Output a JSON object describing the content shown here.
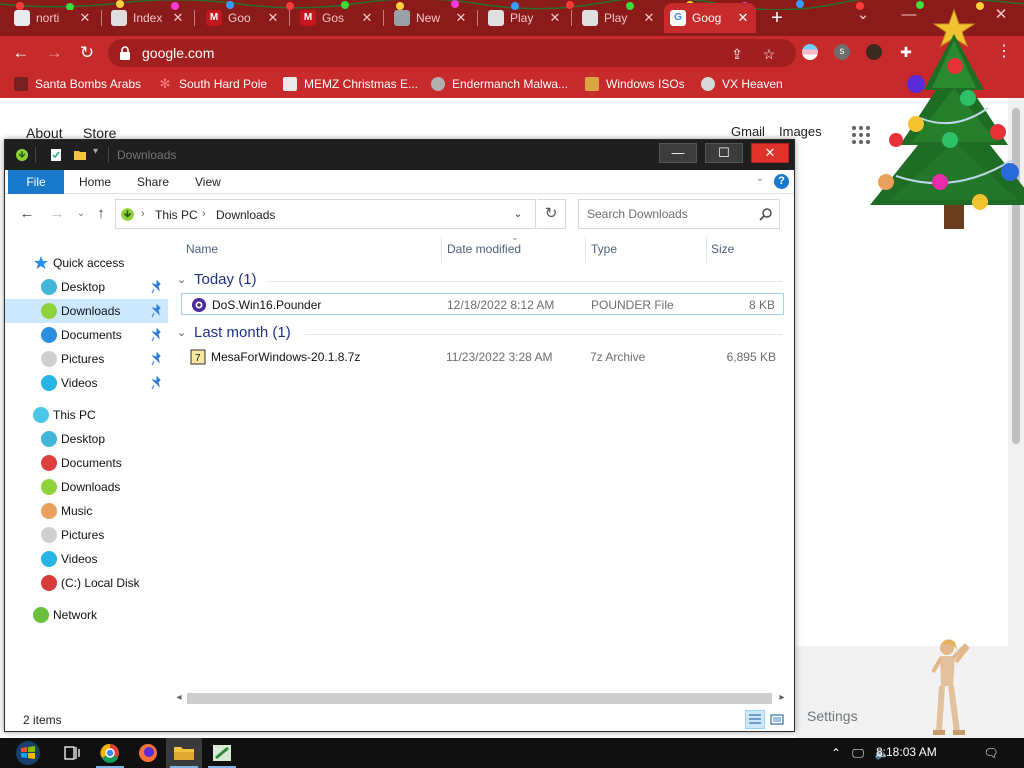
{
  "browser": {
    "tabs": [
      {
        "label": "norti",
        "fav_color": "#e8eaed",
        "fav_text": ""
      },
      {
        "label": "Index",
        "fav_color": "#dedede",
        "fav_text": ""
      },
      {
        "label": "Goo",
        "fav_color": "#c4161c",
        "fav_text": "M"
      },
      {
        "label": "Gos",
        "fav_color": "#c4161c",
        "fav_text": "M"
      },
      {
        "label": "New",
        "fav_color": "#9aa0a6",
        "fav_text": ""
      },
      {
        "label": "Play",
        "fav_color": "#e0e0e0",
        "fav_text": ""
      },
      {
        "label": "Play",
        "fav_color": "#e0e0e0",
        "fav_text": ""
      },
      {
        "label": "Goog",
        "fav_color": "#ffffff",
        "fav_text": "G"
      }
    ],
    "url": "google.com",
    "bookmarks": [
      {
        "label": "Santa Bombs Arabs"
      },
      {
        "label": "South Hard Pole"
      },
      {
        "label": "MEMZ Christmas E..."
      },
      {
        "label": "Endermanch Malwa..."
      },
      {
        "label": "Windows ISOs"
      },
      {
        "label": "VX Heaven"
      }
    ],
    "accent": "#c62a2a"
  },
  "google": {
    "about": "About",
    "store": "Store",
    "gmail": "Gmail",
    "images": "Images",
    "settings": "Settings"
  },
  "explorer": {
    "title": "Downloads",
    "ribbon": {
      "file": "File",
      "home": "Home",
      "share": "Share",
      "view": "View",
      "help": "?"
    },
    "breadcrumb": [
      "This PC",
      "Downloads"
    ],
    "search_placeholder": "Search Downloads",
    "nav": {
      "quick_access": "Quick access",
      "quick": [
        {
          "label": "Desktop",
          "color": "#3fb7d8"
        },
        {
          "label": "Downloads",
          "color": "#8fd33b"
        },
        {
          "label": "Documents",
          "color": "#2a8ee0"
        },
        {
          "label": "Pictures",
          "color": "#cfcfcf"
        },
        {
          "label": "Videos",
          "color": "#27b5e8"
        }
      ],
      "this_pc": "This PC",
      "pc": [
        {
          "label": "Desktop",
          "color": "#3fb7d8"
        },
        {
          "label": "Documents",
          "color": "#e04040"
        },
        {
          "label": "Downloads",
          "color": "#8fd33b"
        },
        {
          "label": "Music",
          "color": "#e8a05a"
        },
        {
          "label": "Pictures",
          "color": "#cfcfcf"
        },
        {
          "label": "Videos",
          "color": "#27b5e8"
        },
        {
          "label": "(C:) Local Disk",
          "color": "#d83a3a"
        }
      ],
      "network": "Network"
    },
    "columns": {
      "name": "Name",
      "date": "Date modified",
      "type": "Type",
      "size": "Size"
    },
    "groups": [
      {
        "label": "Today (1)",
        "files": [
          {
            "name": "DoS.Win16.Pounder",
            "date": "12/18/2022 8:12 AM",
            "type": "POUNDER File",
            "size": "8 KB"
          }
        ]
      },
      {
        "label": "Last month (1)",
        "files": [
          {
            "name": "MesaForWindows-20.1.8.7z",
            "date": "11/23/2022 3:28 AM",
            "type": "7z Archive",
            "size": "6,895 KB"
          }
        ]
      }
    ],
    "status": "2 items"
  },
  "taskbar": {
    "clock": "8:18:03 AM"
  }
}
